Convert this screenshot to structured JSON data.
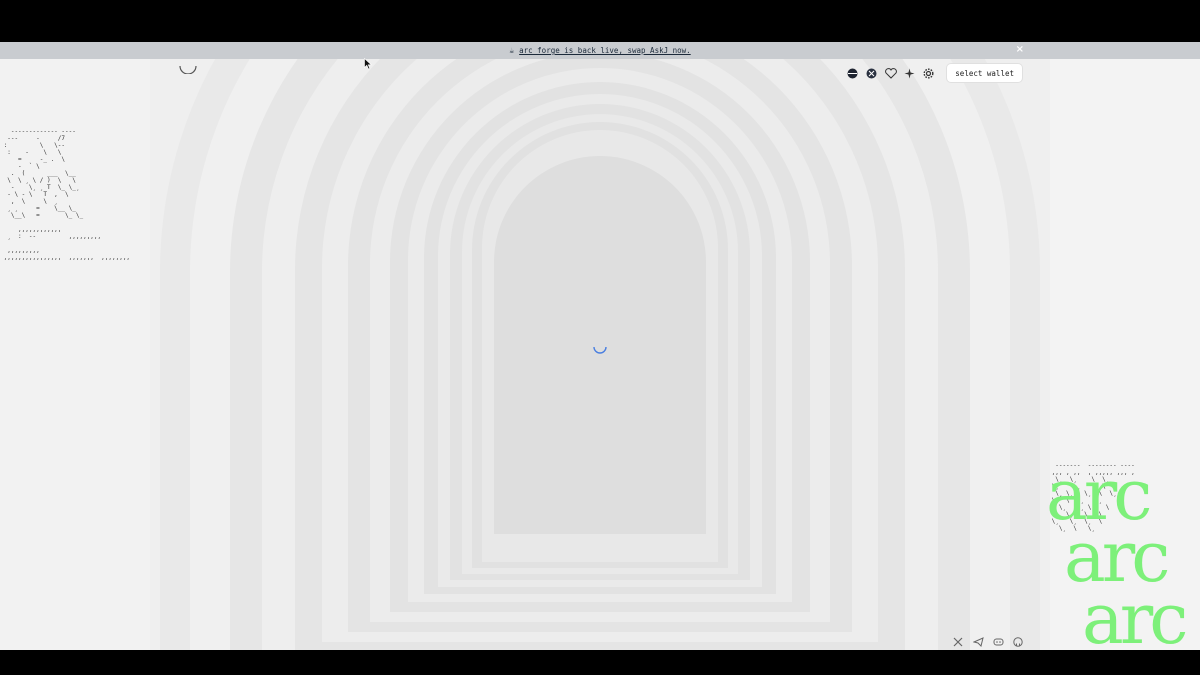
{
  "banner": {
    "glyph": "☕",
    "text": "arc forge is back live, swap AskJ now.",
    "close_label": "×"
  },
  "toolbar": {
    "icons": [
      "globe-dark-icon",
      "globe-light-icon",
      "heart-icon",
      "sparkle-icon",
      "gear-icon"
    ],
    "wallet_label": "select wallet"
  },
  "brand": {
    "words": [
      "arc",
      "arc",
      "arc"
    ],
    "color": "#7df07a"
  },
  "ascii": {
    "left": "   ------------- ----\n  ---     -     /7\n :         \\   \\--\n  :    -    \\   \\\n     =     -_ .  \\\n     -  ` \\\n   .  (      ___  \\__\n  \\  \\ ¸ \\ / )  \\   \\\n   -    \\¸ ¸ T  \\_ \\_¸\n  - \\ - \\   T  ,  \\\n   ,  \\     \\  ¸\n  ¸ ¸     =    \\__ \\_\n   \\__\\   =       \\_ \\_\n\n     ,,,,,,,,,,,,\n  ¸  :  --         ,,,,,,,,,\n\n  ,,,,,,,,,\n ,,,,,,,,,,,,,,,,  ,,,,,,,  ,,,,,,,,",
    "right": "  -------  -------- ----\n ,,, , ,,  , ,,,,, ,,, ,\n  \\¸  \\¸    \\  \\¸\n \\¸    \\¸      \\\n  \\¸ \\¸   \\¸  \\  \\¸\n \\¸  \\  \\¸   \\¸\n   \\¸   \\¸ \\¸   \\\n  \\¸ \\¸   \\   \\¸\n \\¸   \\¸  \\¸  \\\n   \\¸  \\   \\¸"
  },
  "social": {
    "icons": [
      "x-icon",
      "telegram-icon",
      "discord-icon",
      "github-icon"
    ]
  }
}
